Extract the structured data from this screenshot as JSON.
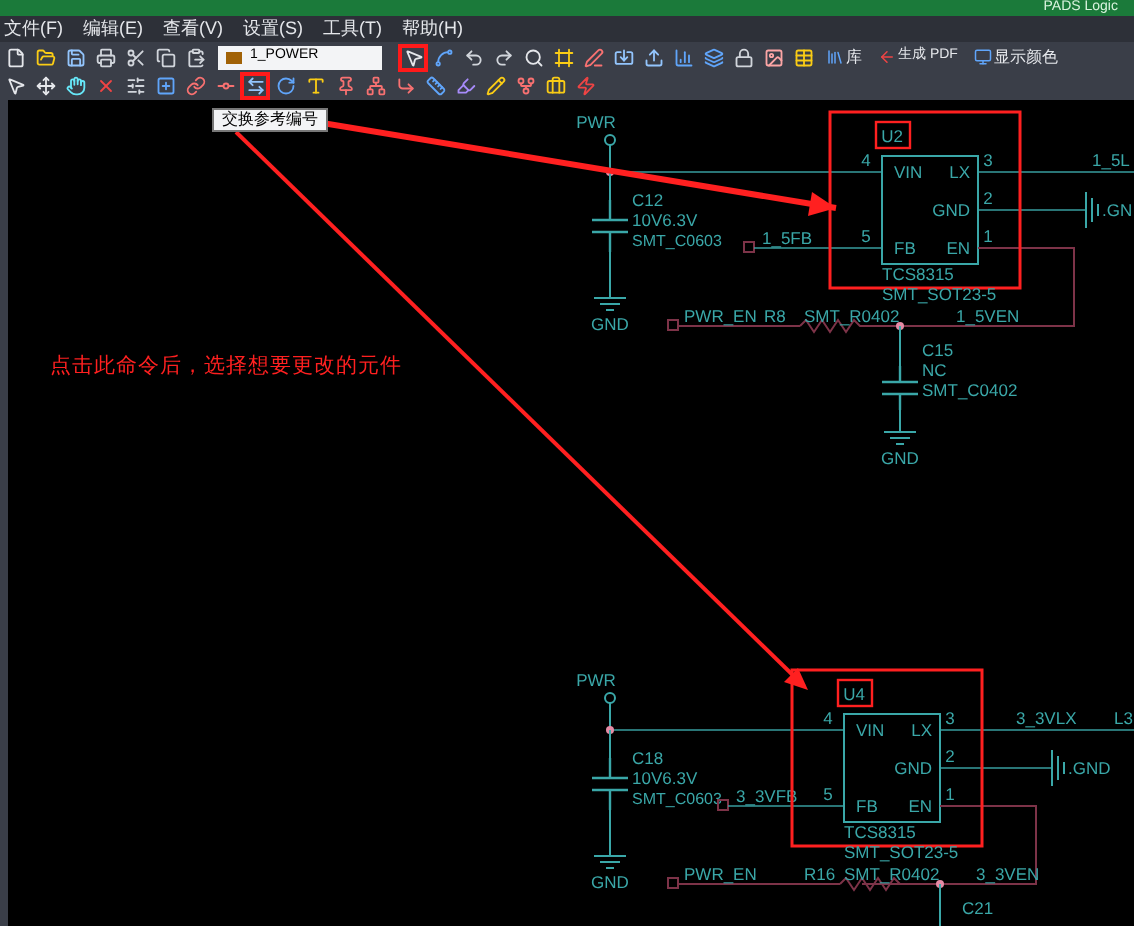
{
  "window": {
    "title": "PADS Logic"
  },
  "menu": [
    "文件(F)",
    "编辑(E)",
    "查看(V)",
    "设置(S)",
    "工具(T)",
    "帮助(H)"
  ],
  "toolbar_top": {
    "tools_before": [
      {
        "kind": "file",
        "highlighted": false
      },
      {
        "kind": "folder",
        "highlighted": false
      },
      {
        "kind": "save",
        "highlighted": false
      },
      {
        "kind": "printer",
        "highlighted": false
      },
      {
        "kind": "scissors",
        "highlighted": false
      },
      {
        "kind": "copy",
        "highlighted": false
      },
      {
        "kind": "paste",
        "highlighted": false
      }
    ],
    "layer_select": "1_POWER",
    "tools_after": [
      {
        "kind": "pointer",
        "highlighted": true
      },
      {
        "kind": "wire",
        "highlighted": false
      },
      {
        "kind": "undo",
        "highlighted": false
      },
      {
        "kind": "redo",
        "highlighted": false
      },
      {
        "kind": "search",
        "highlighted": false
      },
      {
        "kind": "frame",
        "highlighted": false
      },
      {
        "kind": "pen",
        "highlighted": false
      },
      {
        "kind": "import",
        "highlighted": false
      },
      {
        "kind": "export",
        "highlighted": false
      },
      {
        "kind": "chart",
        "highlighted": false
      },
      {
        "kind": "layers",
        "highlighted": false
      },
      {
        "kind": "lock",
        "highlighted": false
      },
      {
        "kind": "image",
        "highlighted": false
      },
      {
        "kind": "table",
        "highlighted": false
      }
    ],
    "library": "库",
    "pdf": "生成 PDF",
    "display_colors": "显示颜色"
  },
  "toolbar_edit": [
    {
      "kind": "pointer",
      "highlighted": false
    },
    {
      "kind": "move",
      "highlighted": false
    },
    {
      "kind": "drag",
      "highlighted": false
    },
    {
      "kind": "delete",
      "highlighted": false
    },
    {
      "kind": "properties",
      "highlighted": false
    },
    {
      "kind": "add-part",
      "highlighted": false
    },
    {
      "kind": "connect",
      "highlighted": false
    },
    {
      "kind": "bus",
      "highlighted": false
    },
    {
      "kind": "swap",
      "highlighted": true
    },
    {
      "kind": "rotate",
      "highlighted": false
    },
    {
      "kind": "text",
      "highlighted": false
    },
    {
      "kind": "pin",
      "highlighted": false
    },
    {
      "kind": "net",
      "highlighted": false
    },
    {
      "kind": "jumper",
      "highlighted": false
    },
    {
      "kind": "rules",
      "highlighted": false
    },
    {
      "kind": "highlight",
      "highlighted": false
    },
    {
      "kind": "edit",
      "highlighted": false
    },
    {
      "kind": "hierarchy",
      "highlighted": false
    },
    {
      "kind": "case",
      "highlighted": false
    },
    {
      "kind": "bolt",
      "highlighted": false
    }
  ],
  "tooltip": "交换参考编号",
  "annotation": "点击此命令后，选择想要更改的元件",
  "circuits": [
    {
      "power": "PWR",
      "input_cap": {
        "ref": "C12",
        "value": "10V6.3V",
        "footprint": "SMT_C0603",
        "ground": "GND"
      },
      "fb_net": "1_5FB",
      "ic": {
        "ref": "U2",
        "part": "TCS8315",
        "footprint": "SMT_SOT23-5",
        "highlighted": true,
        "ref_highlighted": true,
        "pins": [
          {
            "kind": "vin",
            "name": "VIN",
            "number": "4"
          },
          {
            "kind": "lx",
            "name": "LX",
            "number": "3"
          },
          {
            "kind": "gnd",
            "name": "GND",
            "number": "2"
          },
          {
            "kind": "fb",
            "name": "FB",
            "number": "5"
          },
          {
            "kind": "en",
            "name": "EN",
            "number": "1"
          }
        ]
      },
      "lx_net": [
        "1_5L"
      ],
      "gnd_net": ".GN",
      "en_input": "PWR_EN",
      "resistor": {
        "ref": "R8",
        "footprint": "SMT_R0402"
      },
      "en_net": "1_5VEN",
      "en_cap": {
        "ref": "C15",
        "value": "NC",
        "footprint": "SMT_C0402",
        "ground": "GND"
      }
    },
    {
      "power": "PWR",
      "input_cap": {
        "ref": "C18",
        "value": "10V6.3V",
        "footprint": "SMT_C0603",
        "ground": "GND"
      },
      "fb_net": "3_3VFB",
      "ic": {
        "ref": "U4",
        "part": "TCS8315",
        "footprint": "SMT_SOT23-5",
        "highlighted": true,
        "ref_highlighted": true,
        "pins": [
          {
            "kind": "vin",
            "name": "VIN",
            "number": "4"
          },
          {
            "kind": "lx",
            "name": "LX",
            "number": "3"
          },
          {
            "kind": "gnd",
            "name": "GND",
            "number": "2"
          },
          {
            "kind": "fb",
            "name": "FB",
            "number": "5"
          },
          {
            "kind": "en",
            "name": "EN",
            "number": "1"
          }
        ]
      },
      "lx_net": [
        "3_3VLX",
        "L3"
      ],
      "gnd_net": ".GND",
      "en_input": "PWR_EN",
      "resistor": {
        "ref": "R16",
        "footprint": "SMT_R0402"
      },
      "en_net": "3_3VEN",
      "en_cap": {
        "ref": "C21"
      }
    }
  ]
}
